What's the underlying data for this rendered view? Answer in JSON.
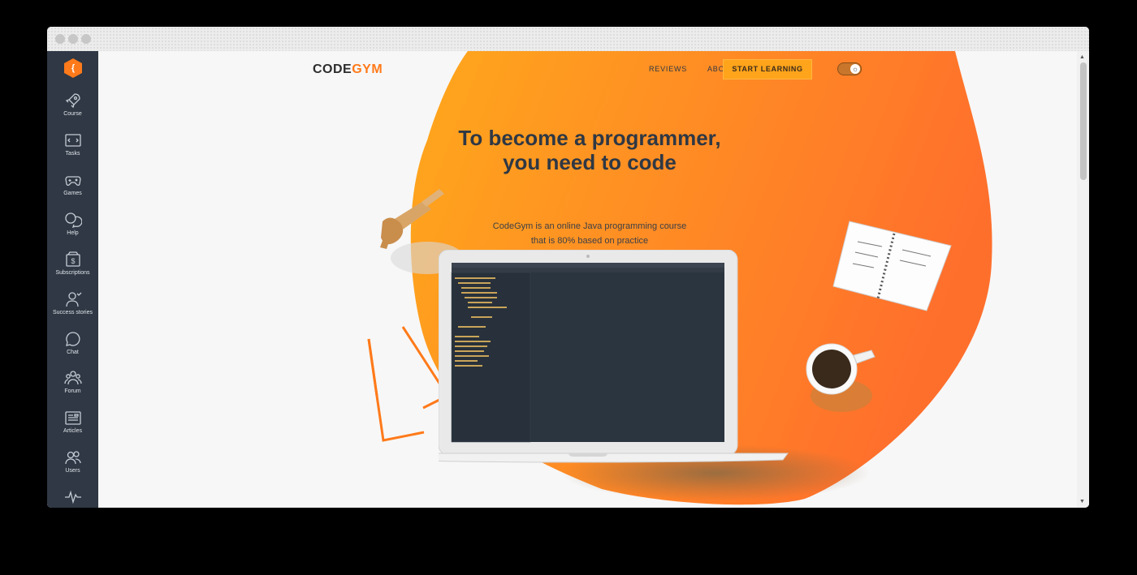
{
  "brand": {
    "prefix": "CODE",
    "accent": "GYM"
  },
  "nav": {
    "reviews": "REVIEWS",
    "about": "ABOUT US",
    "cta": "START LEARNING"
  },
  "theme_toggle": {
    "icon": "sun-icon",
    "state": "dark"
  },
  "hero": {
    "title_line1": "To become a programmer,",
    "title_line2": "you need to code",
    "subtitle_line1": "CodeGym is an online Java programming course",
    "subtitle_line2": "that is 80% based on practice"
  },
  "sidebar": {
    "logo": "{",
    "items": [
      {
        "label": "Course",
        "icon": "rocket-icon"
      },
      {
        "label": "Tasks",
        "icon": "code-brackets-icon"
      },
      {
        "label": "Games",
        "icon": "gamepad-icon"
      },
      {
        "label": "Help",
        "icon": "chat-bubbles-icon"
      },
      {
        "label": "Subscriptions",
        "icon": "dollar-card-icon"
      },
      {
        "label": "Success stories",
        "icon": "user-success-icon"
      },
      {
        "label": "Chat",
        "icon": "chat-icon"
      },
      {
        "label": "Forum",
        "icon": "group-icon"
      },
      {
        "label": "Articles",
        "icon": "newspaper-icon"
      },
      {
        "label": "Users",
        "icon": "users-icon"
      },
      {
        "label": "",
        "icon": "pulse-icon"
      }
    ]
  },
  "colors": {
    "accent": "#ff7a1a",
    "sidebar_bg": "#2f3844",
    "blob_start": "#ffa81c",
    "blob_end": "#ff6f2c",
    "cta_bg": "#ffa41b",
    "text_dark": "#2f3844"
  }
}
